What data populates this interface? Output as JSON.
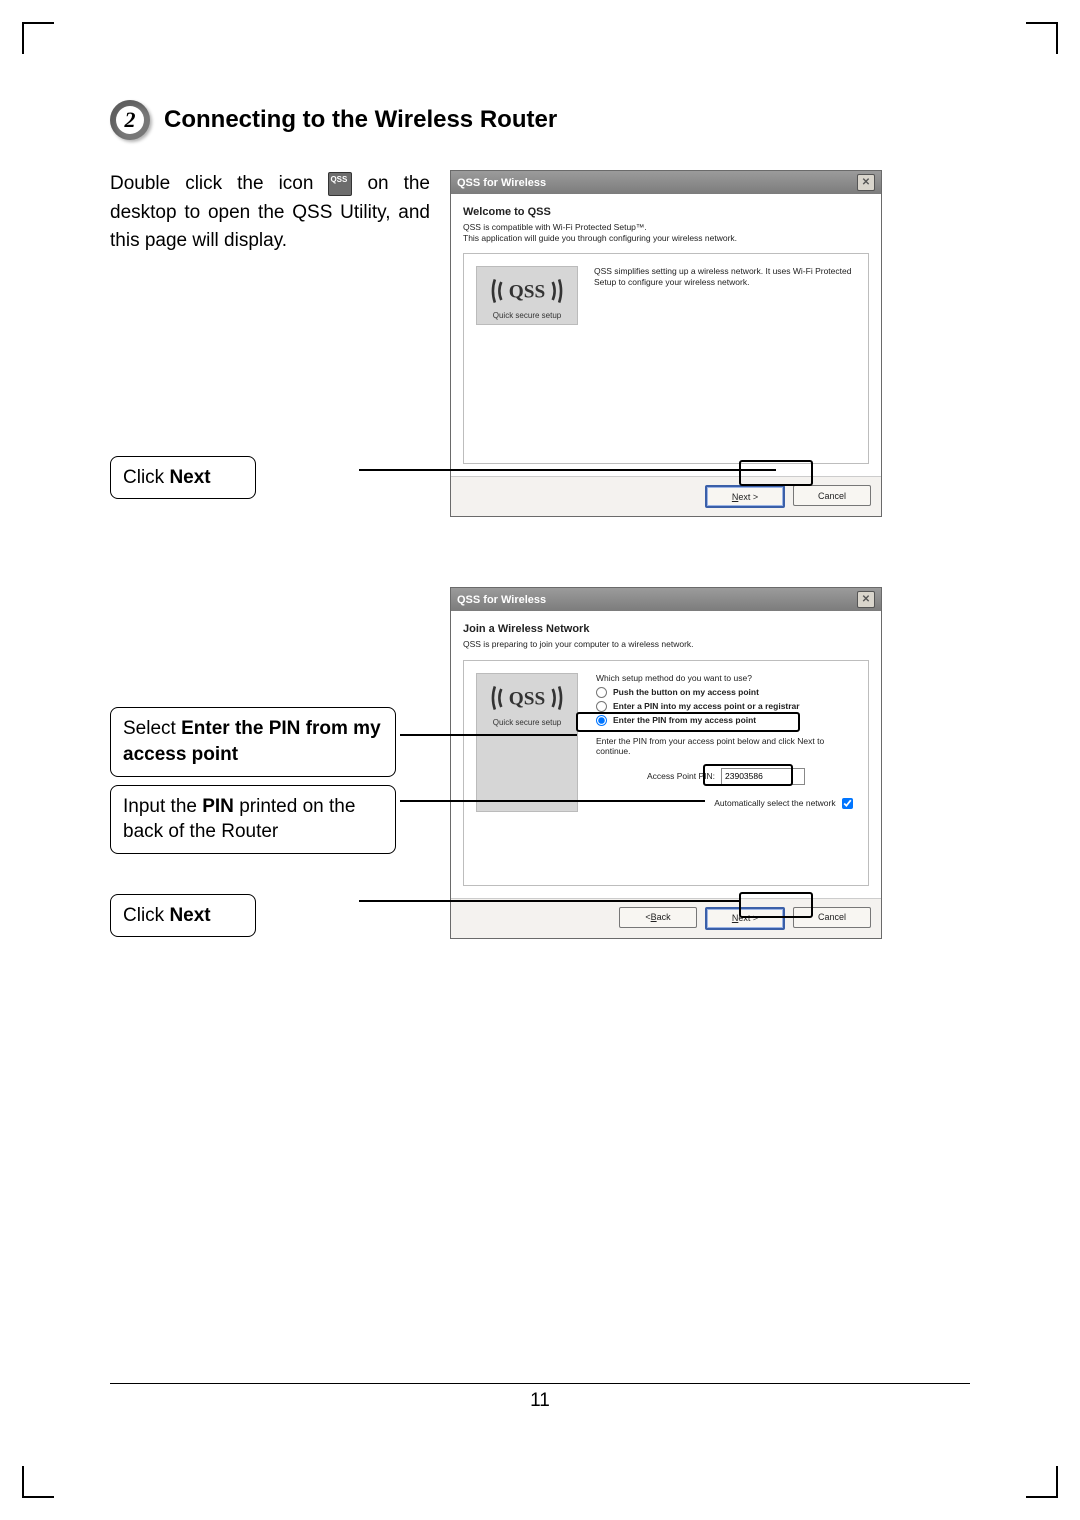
{
  "section": {
    "step_number": "2",
    "title": "Connecting to the Wireless Router"
  },
  "intro": {
    "pre": "Double click the icon ",
    "post": " on the desktop to open the QSS Utility, and this page will display."
  },
  "callouts": {
    "c1_pre": "Click ",
    "c1_bold": "Next",
    "c2_pre": "Select ",
    "c2_bold": "Enter the PIN from my access point",
    "c3_pre": "Input the ",
    "c3_bold": "PIN",
    "c3_post": " printed on the back of the Router",
    "c4_pre": "Click ",
    "c4_bold": "Next"
  },
  "win1": {
    "title": "QSS for Wireless",
    "heading": "Welcome to QSS",
    "sub1": "QSS is compatible with Wi-Fi Protected Setup™.",
    "sub2": "This application will guide you through configuring your wireless network.",
    "desc": "QSS simplifies setting up a wireless network. It uses Wi-Fi Protected Setup to configure your wireless network.",
    "qss_caption": "Quick secure setup",
    "next": "Next >",
    "cancel": "Cancel"
  },
  "win2": {
    "title": "QSS for Wireless",
    "heading": "Join a Wireless Network",
    "sub": "QSS is preparing to join your computer to a wireless network.",
    "question": "Which setup method do you want to use?",
    "opt1": "Push the button on my access point",
    "opt2": "Enter a PIN into my access point or a registrar",
    "opt3": "Enter the PIN from my access point",
    "hint": "Enter the PIN from your access point below and click Next to continue.",
    "pin_label": "Access Point PIN:",
    "pin_value": "23903586",
    "auto": "Automatically select the network",
    "back": "< Back",
    "next": "Next >",
    "cancel": "Cancel",
    "qss_caption": "Quick secure setup"
  },
  "page_number": "11"
}
